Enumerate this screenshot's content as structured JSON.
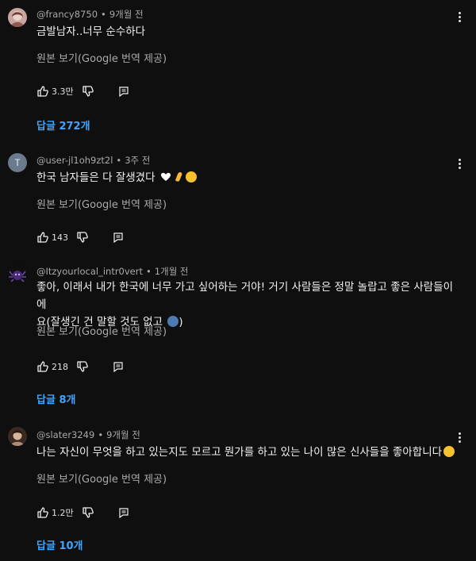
{
  "translate_label": "원본 보기(Google 번역 제공)",
  "comments": [
    {
      "handle": "@francy8750",
      "time": "9개월 전",
      "text": "금발남자..너무 순수하다",
      "likes": "3.3만",
      "replies": "답글 272개"
    },
    {
      "handle": "@user-jl1oh9zt2l",
      "avatar_letter": "T",
      "time": "3주 전",
      "text": "한국 남자들은 다 잘생겼다",
      "emojis": [
        "white-heart",
        "pinched-fingers",
        "smiling-face"
      ],
      "likes": "143"
    },
    {
      "handle": "@Itzyourlocal_intr0vert",
      "time": "1개월 전",
      "text_line1": "좋아, 이래서 내가 한국에 너무 가고 싶어하는 거야! 거기 사람들은 정말 놀랍고 좋은 사람들이에",
      "text_line2": "요(잘생긴 건 말할 것도 없고",
      "text_line2_end": ")",
      "emojis": [
        "blue-face"
      ],
      "likes": "218",
      "replies": "답글 8개"
    },
    {
      "handle": "@slater3249",
      "time": "9개월 전",
      "text": "나는 자신이 무엇을 하고 있는지도 모르고 뭔가를 하고 있는 나이 많은 신사들을 좋아합니다",
      "emojis": [
        "grinning-face"
      ],
      "likes": "1.2만",
      "replies": "답글 10개"
    }
  ]
}
